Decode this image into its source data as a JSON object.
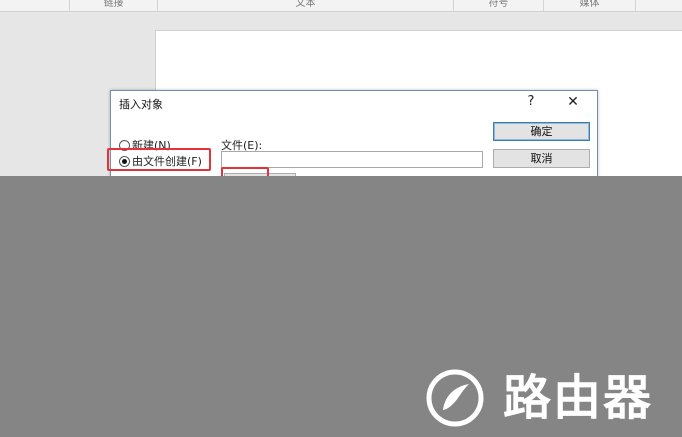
{
  "ribbon": {
    "groups": [
      "链接",
      "文本",
      "符号",
      "媒体"
    ]
  },
  "dialog": {
    "title": "插入对象",
    "help": "?",
    "close": "✕",
    "option_new": "新建(N)",
    "option_from_file": "由文件创建(F)",
    "file_label": "文件(E):",
    "file_value": "",
    "ok_label": "确定",
    "cancel_label": "取消"
  },
  "watermark": {
    "text": "路由器"
  },
  "colors": {
    "highlight": "#e0343a",
    "overlay": "#858585"
  }
}
